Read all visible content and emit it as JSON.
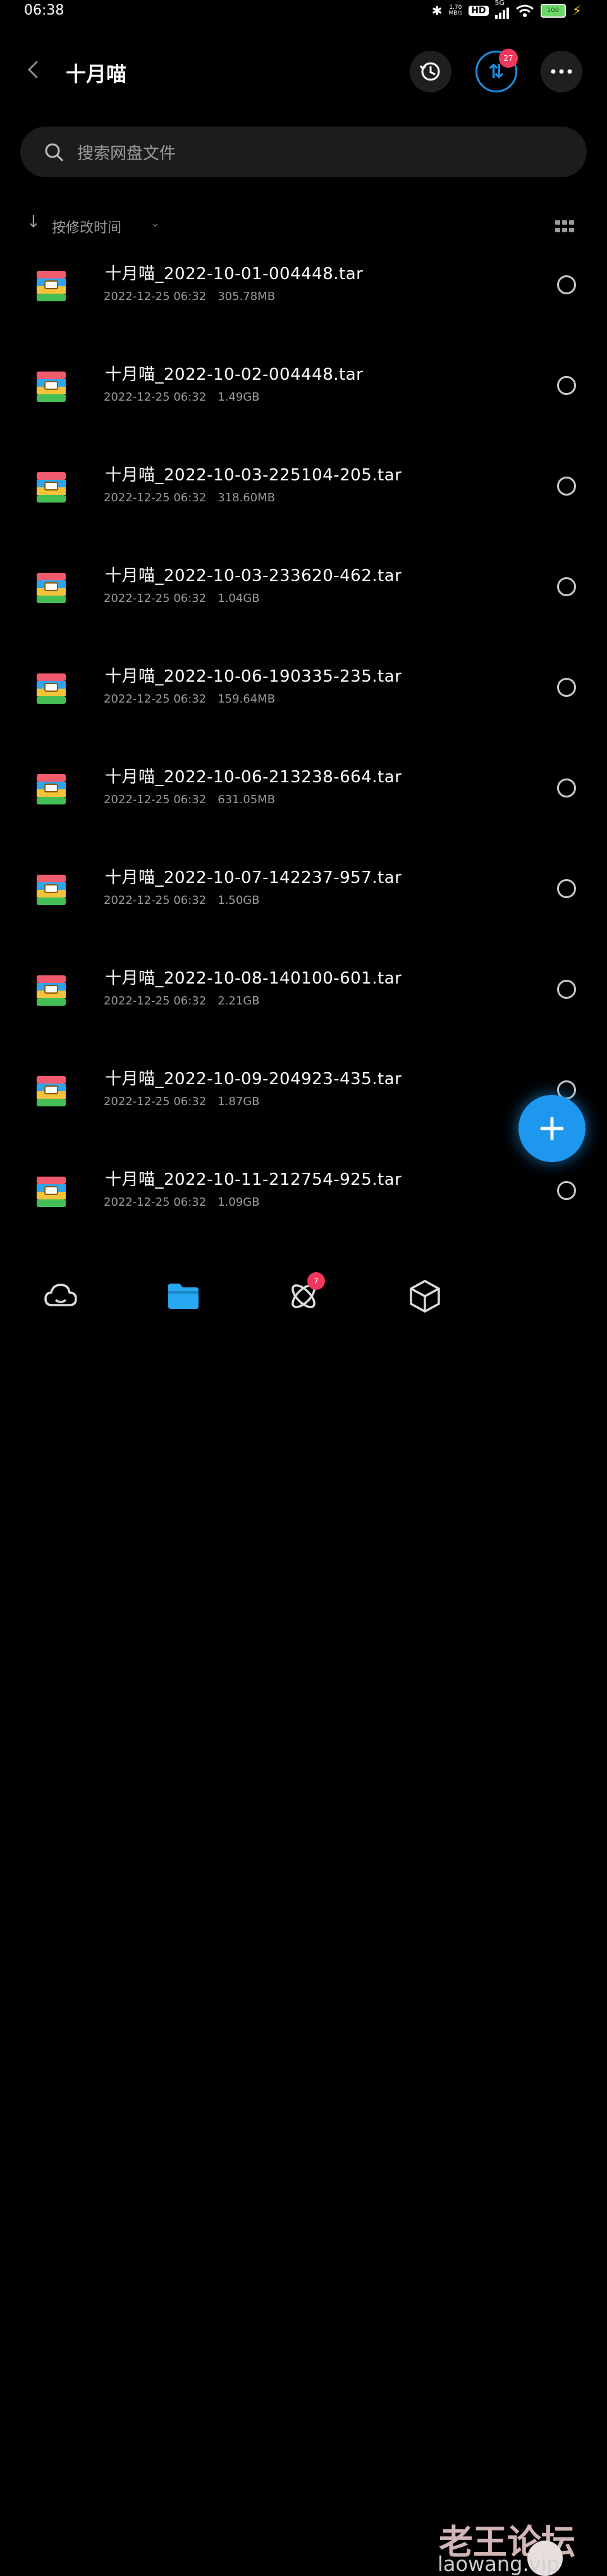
{
  "status_bar": {
    "time": "06:38",
    "net_speed": "1.70",
    "net_unit": "MB/s",
    "hd": "HD",
    "network": "5G",
    "battery": "100"
  },
  "header": {
    "title": "十月喵",
    "transfer_badge": "27"
  },
  "search": {
    "placeholder": "搜索网盘文件"
  },
  "sort": {
    "label": "按修改时间"
  },
  "files": [
    {
      "name": "十月喵_2022-10-01-004448.tar",
      "date": "2022-12-25  06:32",
      "size": "305.78MB"
    },
    {
      "name": "十月喵_2022-10-02-004448.tar",
      "date": "2022-12-25  06:32",
      "size": "1.49GB"
    },
    {
      "name": "十月喵_2022-10-03-225104-205.tar",
      "date": "2022-12-25  06:32",
      "size": "318.60MB"
    },
    {
      "name": "十月喵_2022-10-03-233620-462.tar",
      "date": "2022-12-25  06:32",
      "size": "1.04GB"
    },
    {
      "name": "十月喵_2022-10-06-190335-235.tar",
      "date": "2022-12-25  06:32",
      "size": "159.64MB"
    },
    {
      "name": "十月喵_2022-10-06-213238-664.tar",
      "date": "2022-12-25  06:32",
      "size": "631.05MB"
    },
    {
      "name": "十月喵_2022-10-07-142237-957.tar",
      "date": "2022-12-25  06:32",
      "size": "1.50GB"
    },
    {
      "name": "十月喵_2022-10-08-140100-601.tar",
      "date": "2022-12-25  06:32",
      "size": "2.21GB"
    },
    {
      "name": "十月喵_2022-10-09-204923-435.tar",
      "date": "2022-12-25  06:32",
      "size": "1.87GB"
    },
    {
      "name": "十月喵_2022-10-11-212754-925.tar",
      "date": "2022-12-25  06:32",
      "size": "1.09GB"
    }
  ],
  "bottom_nav": {
    "share_badge": "7"
  },
  "watermark": {
    "title": "老王论坛",
    "url": "laowang.vip"
  },
  "colors": {
    "accent": "#1e97ef",
    "badge": "#f0375e",
    "background": "#000000"
  },
  "icons": {
    "file": "archive-icon",
    "history": "history-icon",
    "transfer": "transfer-icon",
    "more": "more-icon",
    "search": "search-icon",
    "fab": "add-icon",
    "nav": [
      "cloud-icon",
      "folder-icon",
      "share-icon",
      "box-icon"
    ]
  }
}
